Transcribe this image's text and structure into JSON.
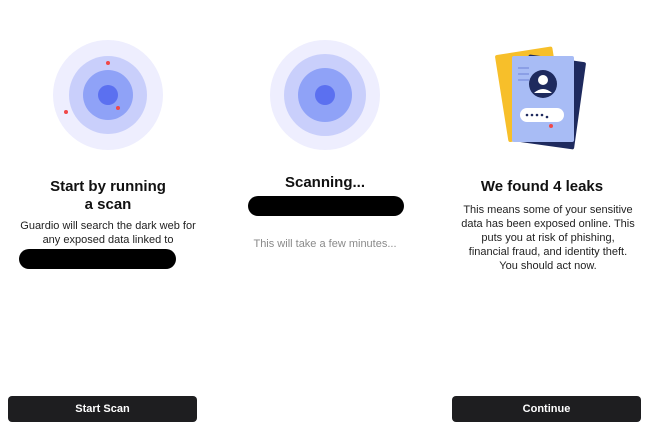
{
  "steps": [
    {
      "title_line1": "Start by running",
      "title_line2": "a scan",
      "description": "Guardio will search the dark web for any exposed data linked to",
      "button_label": "Start Scan"
    },
    {
      "title": "Scanning...",
      "note": "This will take a few minutes..."
    },
    {
      "title": "We found 4 leaks",
      "description": "This means some of your sensitive data has been exposed online. This puts you at risk of phishing, financial fraud, and identity theft. You should act now.",
      "button_label": "Continue"
    }
  ],
  "colors": {
    "radar_outer": "#eeeefe",
    "radar_mid": "#c9cffb",
    "radar_inner": "#8fa2f7",
    "radar_core": "#5b70f0",
    "alert_dot": "#f04848",
    "doc_yellow": "#f7bf2a",
    "doc_navy": "#1e2a5e",
    "doc_card": "#a8bcf5",
    "button_bg": "#1e1e20"
  },
  "icons": [
    "radar-scan-icon",
    "radar-scanning-icon",
    "leaked-documents-icon"
  ]
}
